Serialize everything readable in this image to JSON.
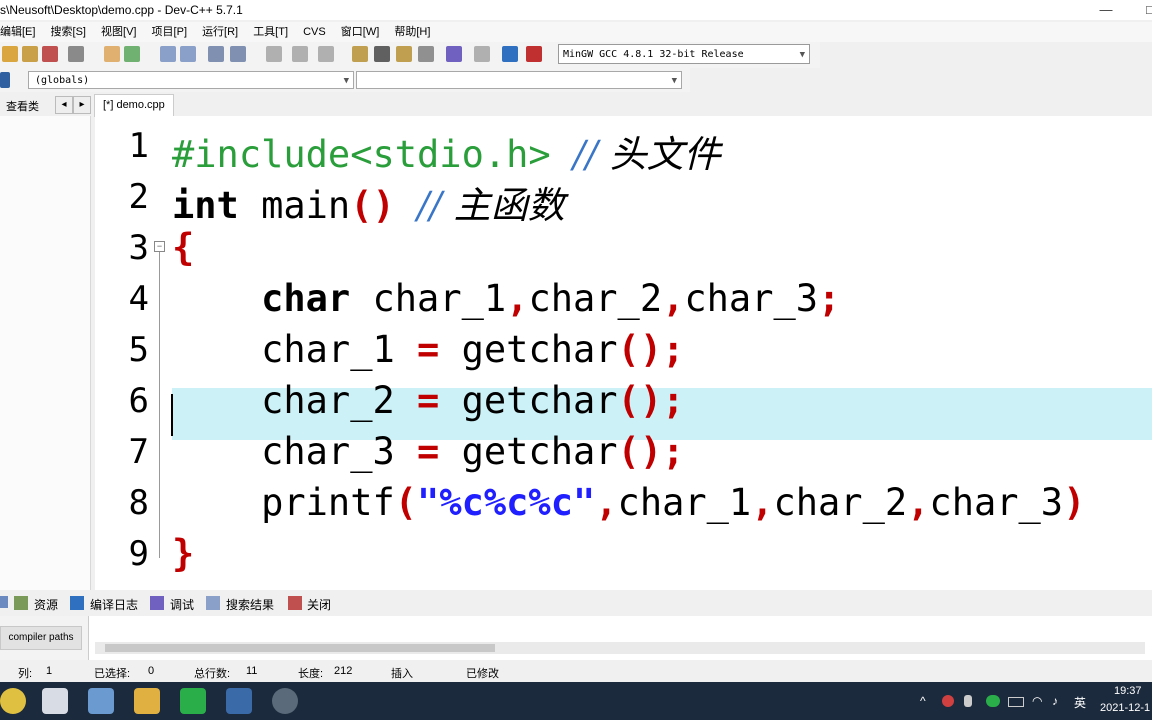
{
  "window": {
    "title": "s\\Neusoft\\Desktop\\demo.cpp - Dev-C++ 5.7.1",
    "minimize": "—",
    "maximize": "□"
  },
  "menu": [
    "编辑[E]",
    "搜索[S]",
    "视图[V]",
    "项目[P]",
    "运行[R]",
    "工具[T]",
    "CVS",
    "窗口[W]",
    "帮助[H]"
  ],
  "toolbar": {
    "compiler": "MinGW GCC 4.8.1 32-bit Release"
  },
  "scope": {
    "left": "(globals)",
    "right": ""
  },
  "left_tabs": {
    "label": "查看类",
    "prev": "◂",
    "next": "▸"
  },
  "editor_tab": "[*] demo.cpp",
  "line_numbers": [
    "1",
    "2",
    "3",
    "4",
    "5",
    "6",
    "7",
    "8",
    "9"
  ],
  "code": [
    {
      "p": [
        {
          "t": "#include<stdio.h>",
          "c": "pre"
        },
        {
          "t": " ",
          "c": ""
        },
        {
          "t": "//",
          "c": "cmt"
        },
        {
          "t": " 头文件",
          "c": "cmtc"
        }
      ]
    },
    {
      "p": [
        {
          "t": "int",
          "c": "kw"
        },
        {
          "t": " main",
          "c": ""
        },
        {
          "t": "()",
          "c": "op"
        },
        {
          "t": " ",
          "c": ""
        },
        {
          "t": "//",
          "c": "cmt"
        },
        {
          "t": " 主函数",
          "c": "cmtc"
        }
      ]
    },
    {
      "p": [
        {
          "t": "{",
          "c": "op"
        }
      ]
    },
    {
      "p": [
        {
          "t": "    ",
          "c": ""
        },
        {
          "t": "char",
          "c": "kw"
        },
        {
          "t": " char_1",
          "c": ""
        },
        {
          "t": ",",
          "c": "op"
        },
        {
          "t": "char_2",
          "c": ""
        },
        {
          "t": ",",
          "c": "op"
        },
        {
          "t": "char_3",
          "c": ""
        },
        {
          "t": ";",
          "c": "op"
        }
      ]
    },
    {
      "p": [
        {
          "t": "    char_1 ",
          "c": ""
        },
        {
          "t": "=",
          "c": "op"
        },
        {
          "t": " getchar",
          "c": ""
        },
        {
          "t": "();",
          "c": "op"
        }
      ]
    },
    {
      "p": [
        {
          "t": "    char_2 ",
          "c": ""
        },
        {
          "t": "=",
          "c": "op"
        },
        {
          "t": " getchar",
          "c": ""
        },
        {
          "t": "();",
          "c": "op"
        }
      ]
    },
    {
      "p": [
        {
          "t": "    char_3 ",
          "c": ""
        },
        {
          "t": "=",
          "c": "op"
        },
        {
          "t": " getchar",
          "c": ""
        },
        {
          "t": "();",
          "c": "op"
        }
      ]
    },
    {
      "p": [
        {
          "t": "    printf",
          "c": ""
        },
        {
          "t": "(",
          "c": "op"
        },
        {
          "t": "\"%c%c%c\"",
          "c": "str"
        },
        {
          "t": ",",
          "c": "op"
        },
        {
          "t": "char_1",
          "c": ""
        },
        {
          "t": ",",
          "c": "op"
        },
        {
          "t": "char_2",
          "c": ""
        },
        {
          "t": ",",
          "c": "op"
        },
        {
          "t": "char_3",
          "c": ""
        },
        {
          "t": ")",
          "c": "op"
        }
      ]
    },
    {
      "p": [
        {
          "t": "}",
          "c": "op"
        }
      ]
    }
  ],
  "bottom_tabs": [
    "资源",
    "编译日志",
    "调试",
    "搜索结果",
    "关闭"
  ],
  "bottom_label": "compiler paths",
  "status": {
    "col_label": "列:",
    "col": "1",
    "sel_label": "已选择:",
    "sel": "0",
    "lines_label": "总行数:",
    "lines": "11",
    "len_label": "长度:",
    "len": "212",
    "mode": "插入",
    "modified": "已修改"
  },
  "tray": {
    "time": "19:37",
    "date": "2021-12-1",
    "ime": "英"
  }
}
